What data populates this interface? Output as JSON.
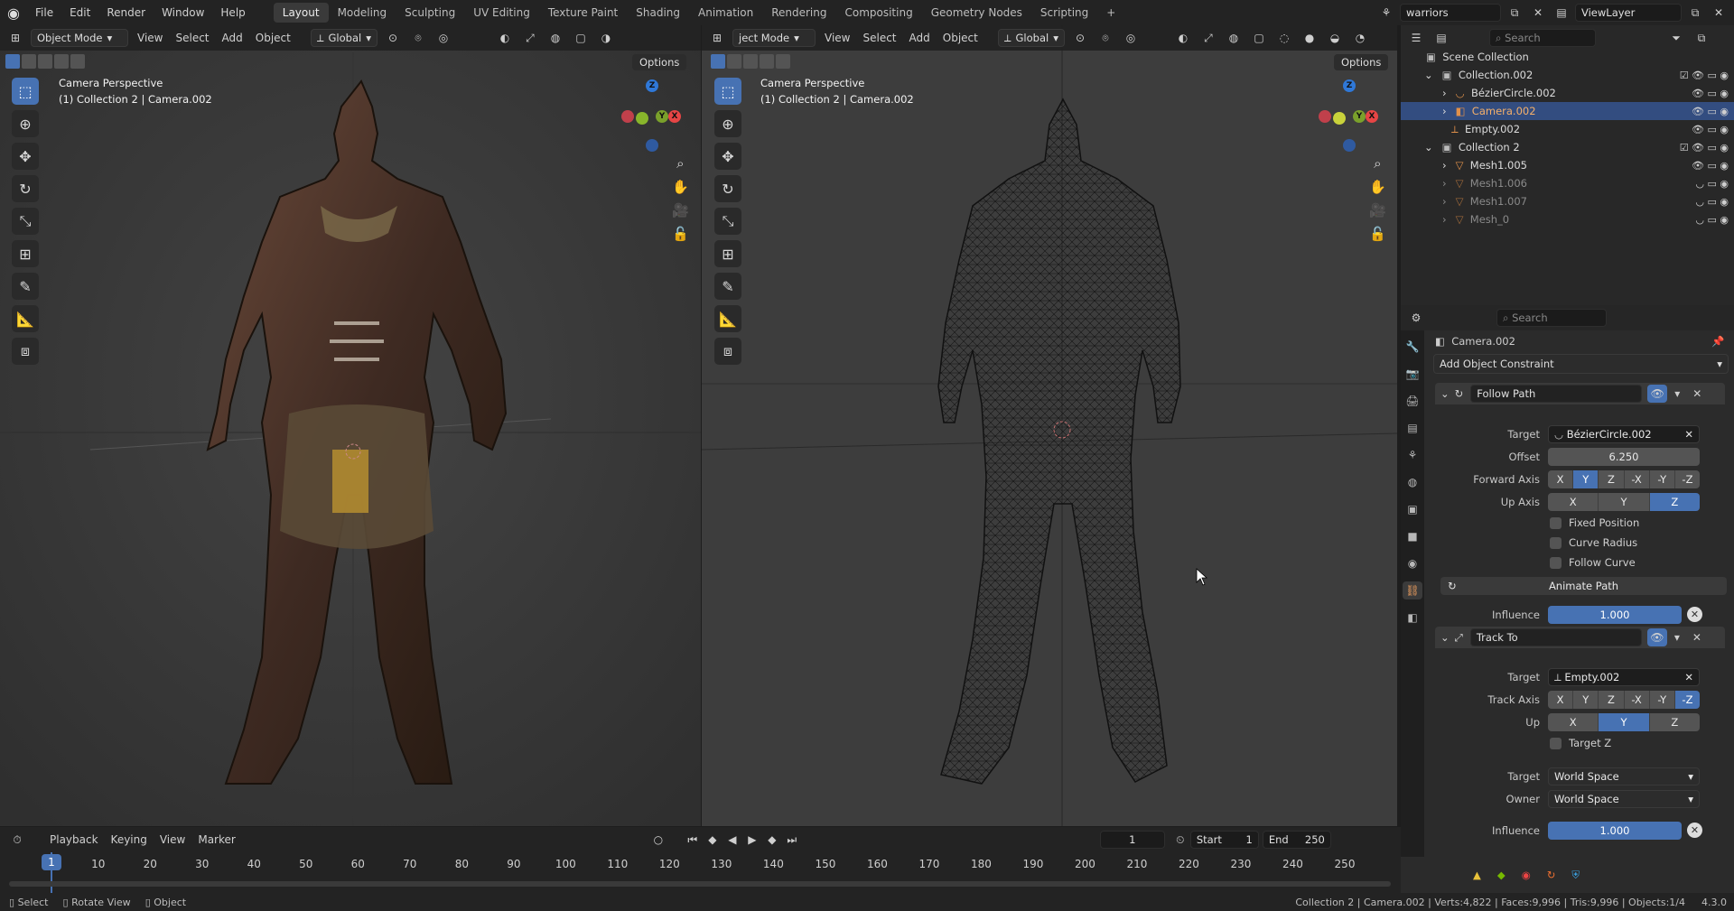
{
  "menu": [
    "File",
    "Edit",
    "Render",
    "Window",
    "Help"
  ],
  "workspaces": [
    "Layout",
    "Modeling",
    "Sculpting",
    "UV Editing",
    "Texture Paint",
    "Shading",
    "Animation",
    "Rendering",
    "Compositing",
    "Geometry Nodes",
    "Scripting"
  ],
  "active_workspace": "Layout",
  "add_tab": "+",
  "scene_name": "warriors",
  "view_layer": "ViewLayer",
  "left_viewport": {
    "mode": "Object Mode",
    "menus": [
      "View",
      "Select",
      "Add",
      "Object"
    ],
    "transform": "Global",
    "options": "Options",
    "camera_title": "Camera Perspective",
    "camera_sub": "(1) Collection 2 | Camera.002"
  },
  "right_viewport": {
    "mode": "ject Mode",
    "menus": [
      "View",
      "Select",
      "Add",
      "Object"
    ],
    "transform": "Global",
    "options": "Options",
    "camera_title": "Camera Perspective",
    "camera_sub": "(1) Collection 2 | Camera.002"
  },
  "outliner": {
    "search_placeholder": "Search",
    "rows": [
      {
        "label": "Scene Collection",
        "indent": 0,
        "icon": "scene-collection-icon"
      },
      {
        "label": "Collection.002",
        "indent": 1,
        "icon": "collection-icon"
      },
      {
        "label": "BézierCircle.002",
        "indent": 2,
        "icon": "curve-icon"
      },
      {
        "label": "Camera.002",
        "indent": 2,
        "icon": "camera-icon",
        "selected": true
      },
      {
        "label": "Empty.002",
        "indent": 2,
        "icon": "empty-icon"
      },
      {
        "label": "Collection 2",
        "indent": 1,
        "icon": "collection-icon"
      },
      {
        "label": "Mesh1.005",
        "indent": 2,
        "icon": "mesh-icon"
      },
      {
        "label": "Mesh1.006",
        "indent": 2,
        "icon": "mesh-icon",
        "dim": true
      },
      {
        "label": "Mesh1.007",
        "indent": 2,
        "icon": "mesh-icon",
        "dim": true
      },
      {
        "label": "Mesh_0",
        "indent": 2,
        "icon": "mesh-icon",
        "dim": true
      }
    ]
  },
  "properties": {
    "search_placeholder": "Search",
    "object_name": "Camera.002",
    "add_constraint": "Add Object Constraint",
    "follow_path": {
      "name": "Follow Path",
      "target_label": "Target",
      "target": "BézierCircle.002",
      "offset_label": "Offset",
      "offset": "6.250",
      "forward_label": "Forward Axis",
      "forward_axes": [
        "X",
        "Y",
        "Z",
        "-X",
        "-Y",
        "-Z"
      ],
      "forward_selected": "Y",
      "up_label": "Up Axis",
      "up_axes": [
        "X",
        "Y",
        "Z"
      ],
      "up_selected": "Z",
      "fixed_position": "Fixed Position",
      "curve_radius": "Curve Radius",
      "follow_curve": "Follow Curve",
      "animate_path": "Animate Path",
      "influence_label": "Influence",
      "influence": "1.000"
    },
    "track_to": {
      "name": "Track To",
      "target_label": "Target",
      "target": "Empty.002",
      "track_label": "Track Axis",
      "track_axes": [
        "X",
        "Y",
        "Z",
        "-X",
        "-Y",
        "-Z"
      ],
      "track_selected": "-Z",
      "up_label": "Up",
      "up_axes": [
        "X",
        "Y",
        "Z"
      ],
      "up_selected": "Y",
      "target_z": "Target Z",
      "target_space_label": "Target",
      "target_space": "World Space",
      "owner_space_label": "Owner",
      "owner_space": "World Space",
      "influence_label": "Influence",
      "influence": "1.000"
    }
  },
  "timeline": {
    "menus": [
      "Playback",
      "Keying",
      "View",
      "Marker"
    ],
    "current_frame": "1",
    "start_label": "Start",
    "start": "1",
    "end_label": "End",
    "end": "250",
    "ticks": [
      "1",
      "10",
      "20",
      "30",
      "40",
      "50",
      "60",
      "70",
      "80",
      "90",
      "100",
      "110",
      "120",
      "130",
      "140",
      "150",
      "160",
      "170",
      "180",
      "190",
      "200",
      "210",
      "220",
      "230",
      "240",
      "250"
    ]
  },
  "status": {
    "select": "Select",
    "rotate": "Rotate View",
    "object": "Object",
    "info": "Collection 2 | Camera.002 | Verts:4,822 | Faces:9,996 | Tris:9,996 | Objects:1/4",
    "version": "4.3.0"
  },
  "colors": {
    "accent": "#4772b3",
    "header": "#232323",
    "viewport_bg": "#3d3d3d",
    "panel_bg": "#2b2b2b"
  }
}
